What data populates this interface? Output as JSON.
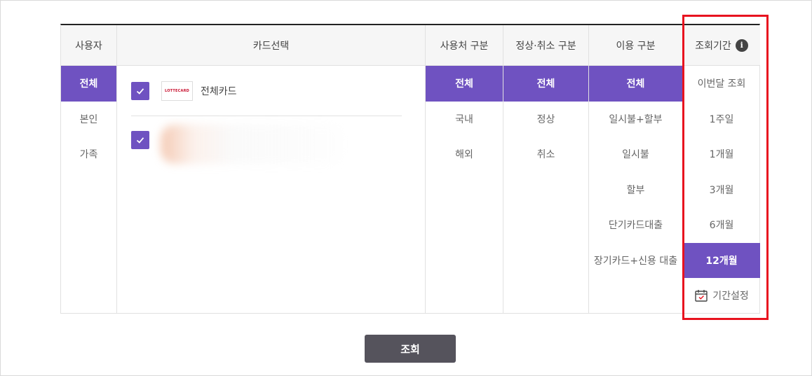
{
  "columns": {
    "user": {
      "header": "사용자",
      "options": [
        "전체",
        "본인",
        "가족"
      ],
      "selected": 0
    },
    "card": {
      "header": "카드선택",
      "cards": [
        {
          "logo": "LOTTECARD",
          "name": "전체카드",
          "checked": true
        },
        {
          "logo": "",
          "name": "",
          "checked": true,
          "blurred": true
        }
      ]
    },
    "place": {
      "header": "사용처 구분",
      "options": [
        "전체",
        "국내",
        "해외"
      ],
      "selected": 0
    },
    "status": {
      "header": "정상·취소 구분",
      "options": [
        "전체",
        "정상",
        "취소"
      ],
      "selected": 0
    },
    "type": {
      "header": "이용 구분",
      "options": [
        "전체",
        "일시불+할부",
        "일시불",
        "할부",
        "단기카드대출",
        "장기카드+신용 대출"
      ],
      "selected": 0
    },
    "period": {
      "header": "조회기간",
      "info_icon": "i",
      "options": [
        "이번달 조회",
        "1주일",
        "1개월",
        "3개월",
        "6개월",
        "12개월"
      ],
      "selected": 5,
      "custom_label": "기간설정"
    }
  },
  "search_button": "조회",
  "colors": {
    "accent": "#6f52c1",
    "highlight": "#e8131f",
    "button": "#55535c"
  }
}
